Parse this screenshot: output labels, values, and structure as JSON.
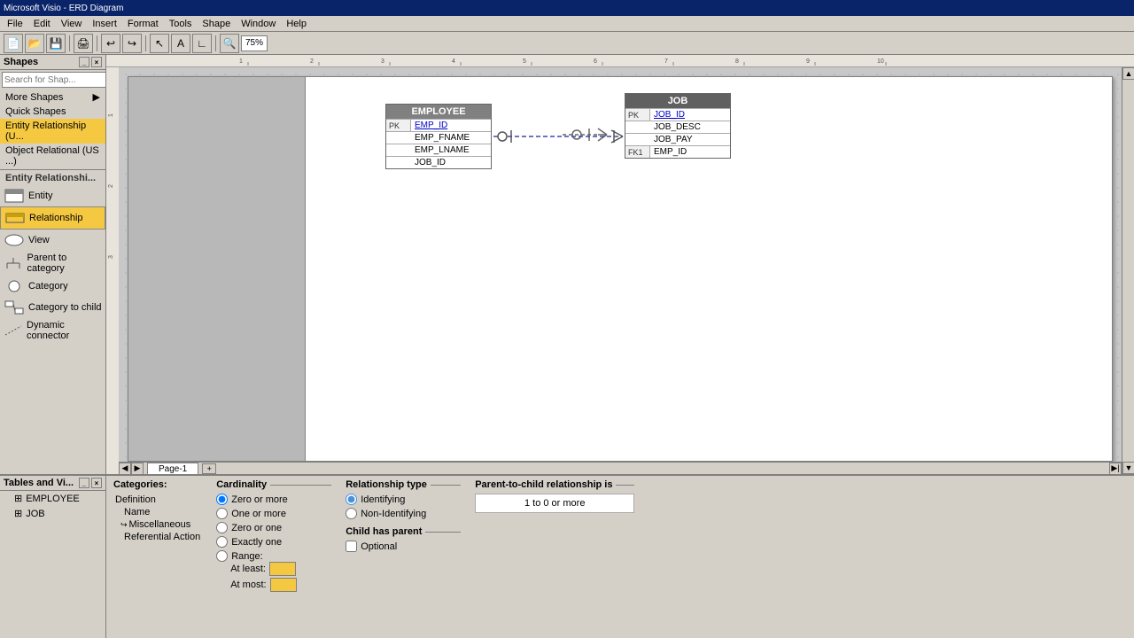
{
  "title": "Microsoft Visio - ERD Diagram",
  "sidebar": {
    "title": "Shapes",
    "search_placeholder": "Search for Shap...",
    "menu_items": [
      {
        "id": "more-shapes",
        "label": "More Shapes",
        "has_arrow": true
      },
      {
        "id": "quick-shapes",
        "label": "Quick Shapes",
        "has_arrow": false
      },
      {
        "id": "entity-relationship-u",
        "label": "Entity Relationship (U...",
        "active": true
      },
      {
        "id": "object-relational-us",
        "label": "Object Relational (US ...)"
      }
    ],
    "er_label": "Entity Relationshi...",
    "shapes": [
      {
        "id": "entity",
        "label": "Entity"
      },
      {
        "id": "relationship",
        "label": "Relationship",
        "active": true
      },
      {
        "id": "view",
        "label": "View"
      },
      {
        "id": "parent-to-category",
        "label": "Parent to category"
      },
      {
        "id": "category",
        "label": "Category"
      },
      {
        "id": "category-to-child",
        "label": "Category to child"
      },
      {
        "id": "dynamic-connector",
        "label": "Dynamic connector"
      }
    ]
  },
  "diagram": {
    "employee_table": {
      "header": "EMPLOYEE",
      "rows": [
        {
          "key": "PK",
          "field": "EMP_ID",
          "linked": true
        },
        {
          "key": "",
          "field": "EMP_FNAME",
          "linked": false
        },
        {
          "key": "",
          "field": "EMP_LNAME",
          "linked": false
        },
        {
          "key": "",
          "field": "JOB_ID",
          "linked": false
        }
      ]
    },
    "job_table": {
      "header": "JOB",
      "rows": [
        {
          "key": "PK",
          "field": "JOB_ID",
          "linked": true
        },
        {
          "key": "",
          "field": "JOB_DESC",
          "linked": false
        },
        {
          "key": "",
          "field": "JOB_PAY",
          "linked": false
        },
        {
          "key": "FK1",
          "field": "EMP_ID",
          "linked": false
        }
      ]
    }
  },
  "tables_panel": {
    "title": "Tables and Vi...",
    "items": [
      {
        "label": "EMPLOYEE",
        "selected": false
      },
      {
        "label": "JOB",
        "selected": false
      }
    ]
  },
  "properties": {
    "header": "Categories:",
    "categories": [
      {
        "label": "Definition",
        "indent": 1
      },
      {
        "label": "Name",
        "indent": 1
      },
      {
        "label": "Miscellaneous",
        "indent": 2
      },
      {
        "label": "Referential Action",
        "indent": 2
      }
    ],
    "cardinality": {
      "title": "Cardinality",
      "options": [
        {
          "label": "Zero or more",
          "selected": true
        },
        {
          "label": "One or more",
          "selected": false
        },
        {
          "label": "Zero or one",
          "selected": false
        },
        {
          "label": "Exactly one",
          "selected": false
        },
        {
          "label": "Range:",
          "selected": false
        }
      ],
      "range": {
        "at_least_label": "At least:",
        "at_most_label": "At most:"
      }
    },
    "relationship_type": {
      "title": "Relationship type",
      "options": [
        {
          "label": "Identifying",
          "selected": true
        },
        {
          "label": "Non-Identifying",
          "selected": false
        }
      ]
    },
    "child_has_parent": {
      "title": "Child has parent",
      "options": [
        {
          "label": "Optional",
          "checked": false
        }
      ]
    },
    "parent_to_child": {
      "title": "Parent-to-child relationship is",
      "summary": "1 to  0 or more"
    }
  },
  "page_tabs": [
    {
      "label": "Page-1",
      "active": true
    }
  ]
}
